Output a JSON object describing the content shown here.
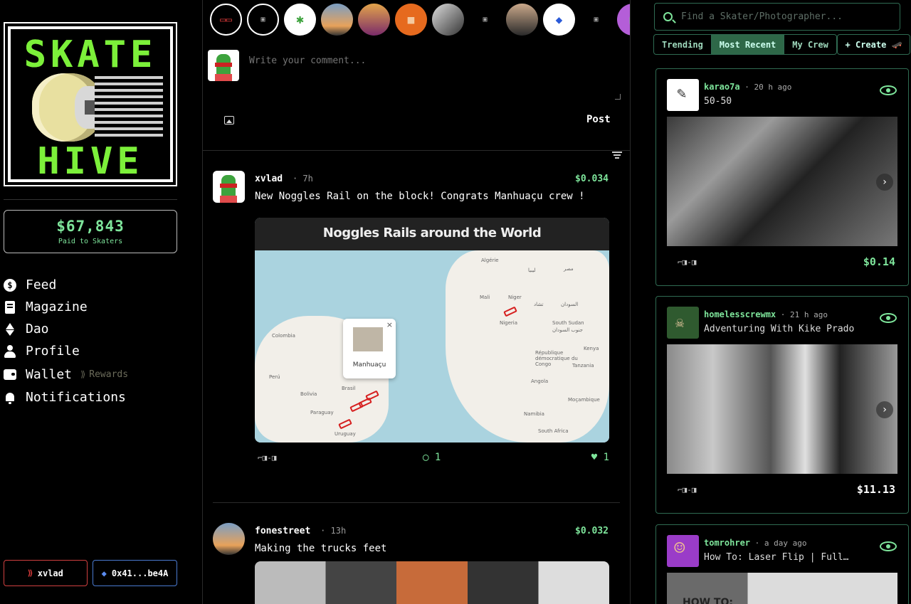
{
  "sidebar": {
    "logo": {
      "top_word": "SKATE",
      "bottom_word": "HIVE"
    },
    "paid": {
      "amount": "$67,843",
      "label": "Paid to Skaters"
    },
    "nav": [
      {
        "label": "Feed",
        "icon": "dollar-circle-icon"
      },
      {
        "label": "Magazine",
        "icon": "book-icon"
      },
      {
        "label": "Dao",
        "icon": "ethereum-icon"
      },
      {
        "label": "Profile",
        "icon": "user-icon"
      },
      {
        "label": "Wallet",
        "icon": "wallet-icon"
      },
      {
        "label": "Notifications",
        "icon": "bell-icon"
      }
    ],
    "rewards_label": "Rewards",
    "user_button": "xvlad",
    "wallet_button": "0x41...be4A"
  },
  "composer": {
    "placeholder": "Write your comment...",
    "post_label": "Post"
  },
  "feed": {
    "posts": [
      {
        "user": "xvlad",
        "time": "· 7h",
        "payout": "$0.034",
        "text": "New Noggles Rail on the block! Congrats Manhuaçu crew !",
        "map": {
          "title": "Noggles Rails around the World",
          "popup_label": "Manhuaçu",
          "close_glyph": "×",
          "labels": [
            "Algérie",
            "ليبيا",
            "مصر",
            "Mali",
            "Niger",
            "تشاد",
            "السودان",
            "Nigeria",
            "South Sudan",
            "جنوب السودان",
            "Kenya",
            "République démocratique du Congo",
            "Tanzania",
            "Angola",
            "Namibia",
            "Moçambique",
            "South Africa",
            "Colombia",
            "Perú",
            "Brasil",
            "Bolivia",
            "Paraguay",
            "Uruguay"
          ]
        },
        "noggle": "⌐◨-◨",
        "comments": "1",
        "likes": "1"
      },
      {
        "user": "fonestreet",
        "time": "· 13h",
        "payout": "$0.032",
        "text": "Making the trucks feet"
      }
    ]
  },
  "right": {
    "search_placeholder": "Find a Skater/Photographer...",
    "tabs": [
      "Trending",
      "Most Recent",
      "My Crew"
    ],
    "active_tab": "Most Recent",
    "create_label": "+ Create 🛹",
    "cards": [
      {
        "user": "karao7a",
        "time": " · 20 h ago",
        "title": "50-50",
        "noggle": "⌐◨-◨",
        "payout": "$0.14",
        "payout_color": "#7ee59b"
      },
      {
        "user": "homelesscrewmx",
        "time": " · 21 h ago",
        "title": "Adventuring With Kike Prado",
        "noggle": "⌐◨-◨",
        "payout": "$11.13",
        "payout_color": "#ffffff"
      },
      {
        "user": "tomrohrer",
        "time": " · a day ago",
        "title": "How To: Laser Flip | Full…",
        "image_text": "HOW TO:"
      }
    ]
  },
  "colors": {
    "accent_green": "#7ee59b",
    "border_green": "#2f6b52",
    "hive_red": "#e03c3c",
    "eth_blue": "#5b8cf0"
  }
}
